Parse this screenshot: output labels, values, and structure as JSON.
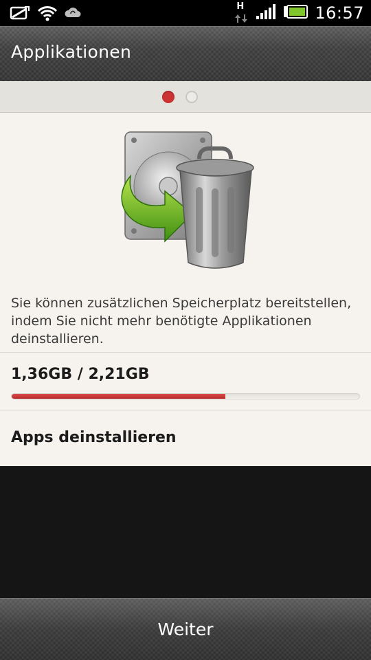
{
  "status_bar": {
    "time": "16:57",
    "network_type": "H",
    "icons": [
      "screenshot-icon",
      "wifi-icon",
      "sync-cloud-icon",
      "data-transfer-icon",
      "signal-icon",
      "battery-icon"
    ]
  },
  "header": {
    "title": "Applikationen"
  },
  "pager": {
    "current_page": 1,
    "total_pages": 2,
    "active_color": "#cc3333"
  },
  "main": {
    "hero_icons": [
      "hard-drive-icon",
      "arrow-icon",
      "trash-can-icon"
    ],
    "description": "Sie können zusätzlichen Speicherplatz bereitstellen, indem Sie nicht mehr benötigte Applikationen deinstallieren.",
    "storage": {
      "label": "1,36GB / 2,21GB",
      "used_fraction": 0.615,
      "bar_color": "#cc3333"
    },
    "action_label": "Apps deinstallieren"
  },
  "footer": {
    "next_label": "Weiter"
  }
}
